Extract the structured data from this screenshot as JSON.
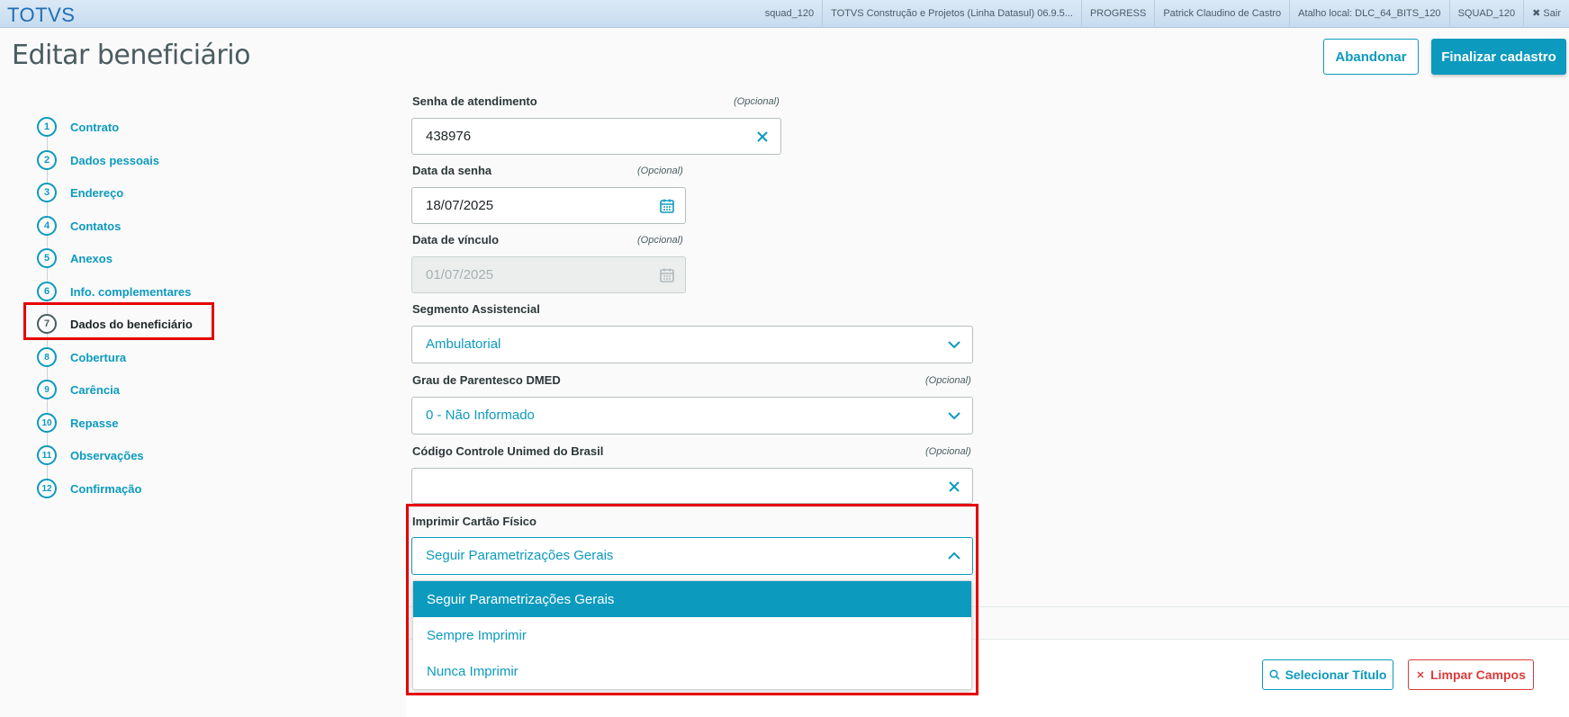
{
  "topbar": {
    "brand": "TOTVS",
    "items": [
      "squad_120",
      "TOTVS Construção e Projetos (Linha Datasul) 06.9.5...",
      "PROGRESS",
      "Patrick Claudino de Castro",
      "Atalho local: DLC_64_BITS_120",
      "SQUAD_120",
      "✖ Sair"
    ]
  },
  "header": {
    "title": "Editar beneficiário",
    "abandon_label": "Abandonar",
    "finish_label": "Finalizar cadastro"
  },
  "steps": [
    {
      "number": "1",
      "label": "Contrato"
    },
    {
      "number": "2",
      "label": "Dados pessoais"
    },
    {
      "number": "3",
      "label": "Endereço"
    },
    {
      "number": "4",
      "label": "Contatos"
    },
    {
      "number": "5",
      "label": "Anexos"
    },
    {
      "number": "6",
      "label": "Info. complementares"
    },
    {
      "number": "7",
      "label": "Dados do beneficiário"
    },
    {
      "number": "8",
      "label": "Cobertura"
    },
    {
      "number": "9",
      "label": "Carência"
    },
    {
      "number": "10",
      "label": "Repasse"
    },
    {
      "number": "11",
      "label": "Observações"
    },
    {
      "number": "12",
      "label": "Confirmação"
    }
  ],
  "form": {
    "senha": {
      "label": "Senha de atendimento",
      "optional": "(Opcional)",
      "value": "438976"
    },
    "data_senha": {
      "label": "Data da senha",
      "optional": "(Opcional)",
      "value": "18/07/2025"
    },
    "data_vinculo": {
      "label": "Data de vínculo",
      "optional": "(Opcional)",
      "value": "01/07/2025"
    },
    "segmento": {
      "label": "Segmento Assistencial",
      "value": "Ambulatorial"
    },
    "grau": {
      "label": "Grau de Parentesco DMED",
      "optional": "(Opcional)",
      "value": "0 - Não Informado"
    },
    "codigo": {
      "label": "Código Controle Unimed do Brasil",
      "optional": "(Opcional)",
      "value": ""
    },
    "imprimir": {
      "label": "Imprimir Cartão Físico",
      "value": "Seguir Parametrizações Gerais",
      "options": [
        "Seguir Parametrizações Gerais",
        "Sempre Imprimir",
        "Nunca Imprimir"
      ]
    }
  },
  "bottom": {
    "select_title_label": "Selecionar Título",
    "clear_label": "Limpar Campos"
  },
  "colors": {
    "accent": "#0c9abe",
    "highlight": "#e60000",
    "danger": "#d93b3b"
  }
}
